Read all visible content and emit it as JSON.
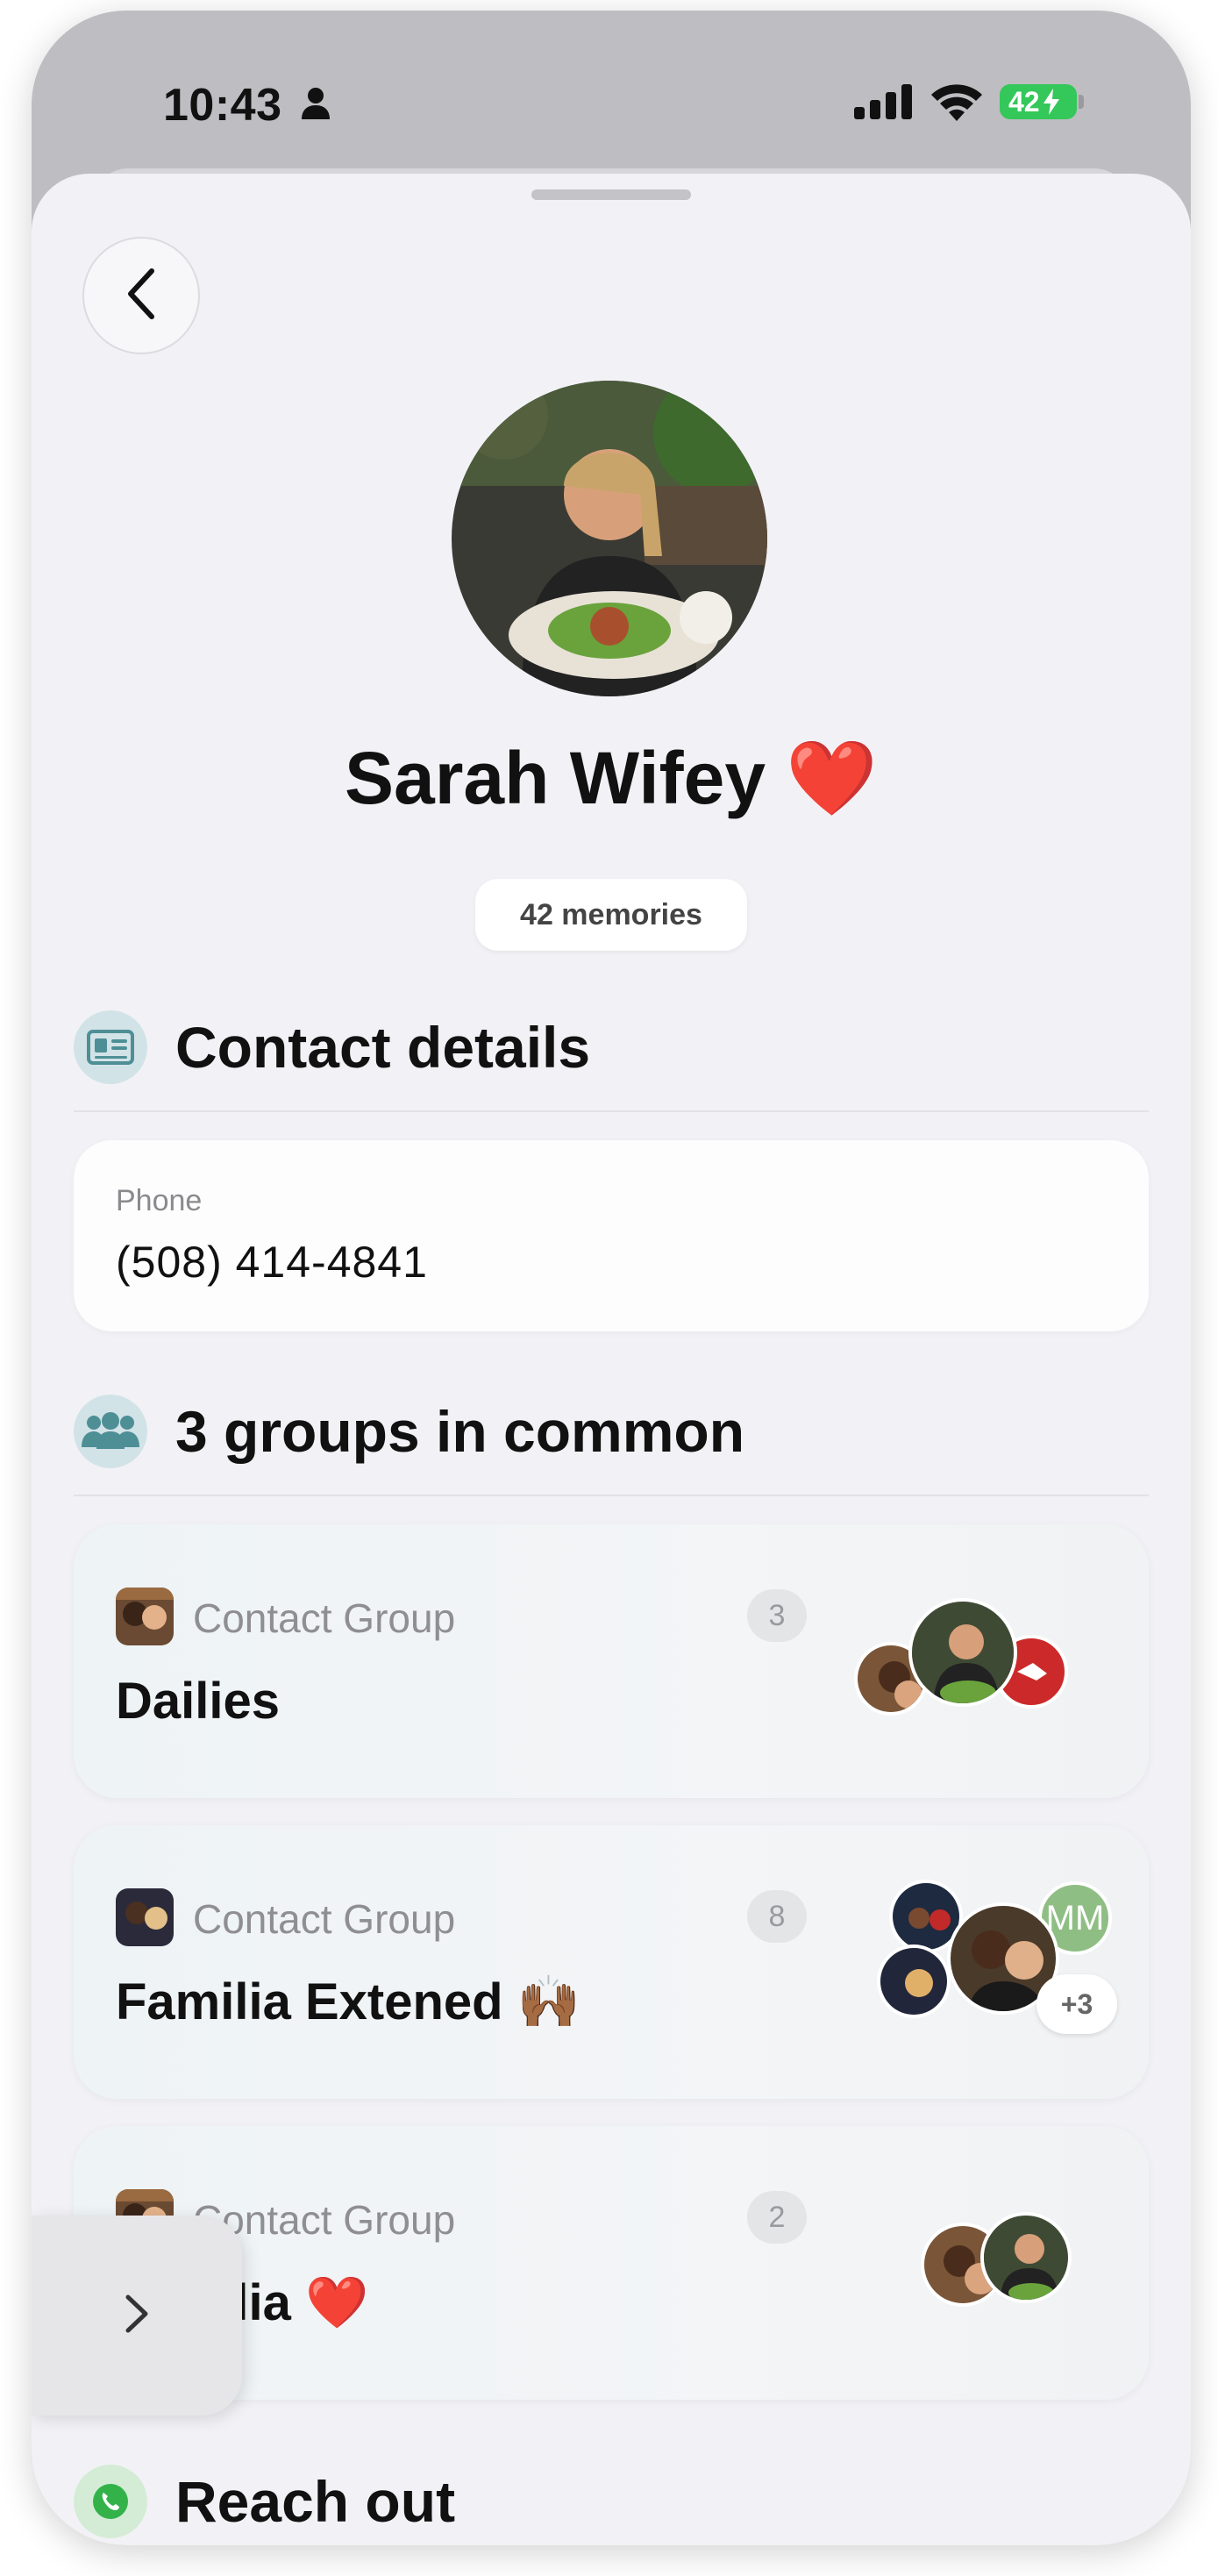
{
  "status_bar": {
    "time": "10:43",
    "battery": "42",
    "icons": [
      "person-icon",
      "signal-icon",
      "wifi-icon",
      "battery-charging-icon"
    ]
  },
  "profile": {
    "name": "Sarah Wifey",
    "emoji": "❤️",
    "memories": "42 memories"
  },
  "contact_details": {
    "title": "Contact details",
    "icon": "id-card-icon",
    "phone_label": "Phone",
    "phone_value": "(508) 414-4841"
  },
  "groups": {
    "title": "3 groups in common",
    "icon": "people-icon",
    "items": [
      {
        "type": "Contact Group",
        "count": "3",
        "name": "Dailies"
      },
      {
        "type": "Contact Group",
        "count": "8",
        "name": "Familia Extened 🙌🏾",
        "member_initials": "MM",
        "more": "+3"
      },
      {
        "type": "Contact Group",
        "count": "2",
        "name": "Familia ❤️"
      }
    ]
  },
  "reach_out": {
    "title": "Reach out",
    "icon": "whatsapp-phone-icon"
  },
  "colors": {
    "accent_teal": "#4e8f96",
    "heart_red": "#e0202c",
    "battery_green": "#34c759"
  }
}
